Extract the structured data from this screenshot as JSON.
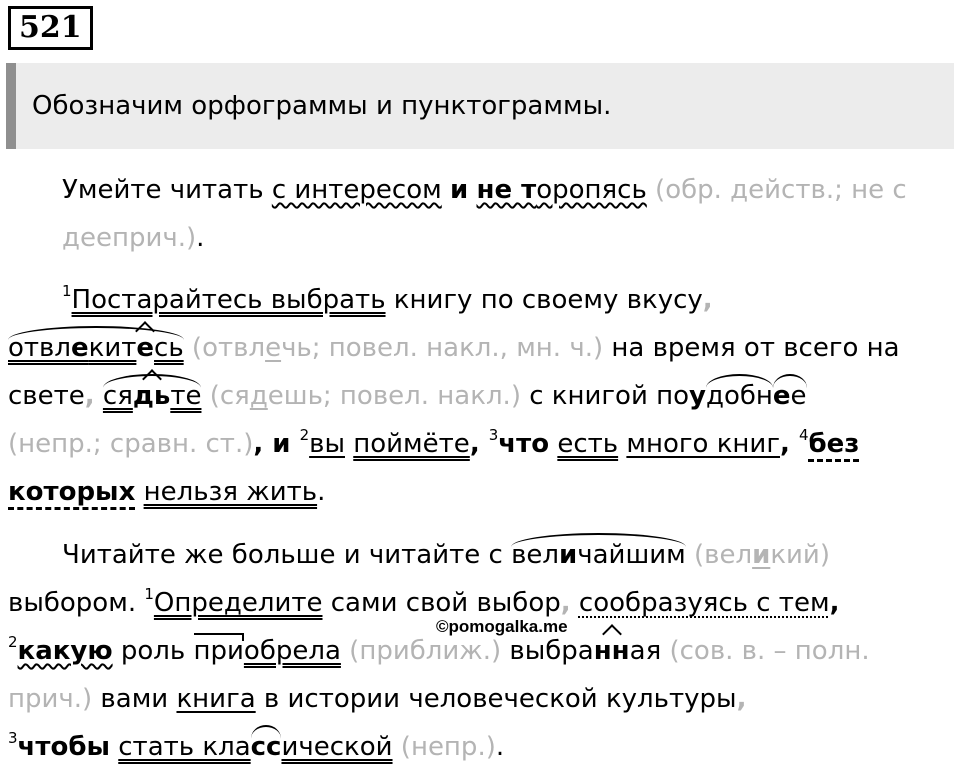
{
  "task": {
    "number": "521"
  },
  "intro": "Обозначим орфограммы и пунктограммы.",
  "p1": {
    "t1": "Умейте читать ",
    "t2": "с интересом",
    "t3": " ",
    "t4": "и",
    "t5": " ",
    "t6a": "не т",
    "t6b": "оропясь",
    "t7": " (обр. действ.; не с дееприч.)",
    "t8": "."
  },
  "p2": {
    "s1": "1",
    "a1": "Постарайтесь выбрать",
    "a2": " книгу по своему вкусу",
    "a3": ",",
    "b1": "отвл",
    "b2": "е",
    "b3": "кит",
    "b4": "е",
    "b5": "сь",
    "b6": " (отвл",
    "b7": "е",
    "b8": "чь; повел. накл., мн. ч.)",
    "b9": " на время от всего на свете",
    "b10": ",",
    "c1": "ся",
    "c2": "дь",
    "c3": "те",
    "c4": " (ся",
    "c5": "д",
    "c6": "ешь; повел. накл.)",
    "c7": " с книгой по",
    "c8": "у",
    "c9": "добн",
    "c10": "е",
    "c11": "е",
    "d1": " (непр.; сравн. ст.)",
    "d2": ", и ",
    "s2": "2",
    "d3": "вы",
    "d4": " ",
    "d5": "поймёте",
    "d6": ", ",
    "s3": "3",
    "d7": "что",
    "d8": " ",
    "d9": "есть",
    "d10": " ",
    "d11": "много книг",
    "d12": ", ",
    "s4": "4",
    "d13": "без которых",
    "d14": " ",
    "d15": "нельзя жить",
    "d16": "."
  },
  "p3": {
    "e1": "Читайте же больше и читайте с ",
    "e2": "вел",
    "e3": "и",
    "e4": "чайшим",
    "e5": " (вел",
    "e6": "и",
    "e7": "кий)",
    "f1": " выбором. ",
    "s1": "1",
    "f2": "Определите",
    "f3": " сами свой выбор",
    "f4": ",",
    "f5": " ",
    "f6": "сообразуясь с тем",
    "f7": ",",
    "s2": "2",
    "g1": "какую",
    "g2": " роль ",
    "g3": "при",
    "g4": "обрела",
    "g5": " (приближ.)",
    "g6": " выбра",
    "g7": "нн",
    "g8": "ая",
    "g9": " (сов. в. – полн. прич.)",
    "g10": " вами ",
    "g11": "книга",
    "g12": " в истории человеческой культуры",
    "g13": ",",
    "s3": "3",
    "h1": "чтобы",
    "h2": " ",
    "h3": "стать кла",
    "h4": "сс",
    "h5": "ической",
    "h6": " (непр.)",
    "h7": "."
  },
  "watermark": "©pomogalka.me"
}
